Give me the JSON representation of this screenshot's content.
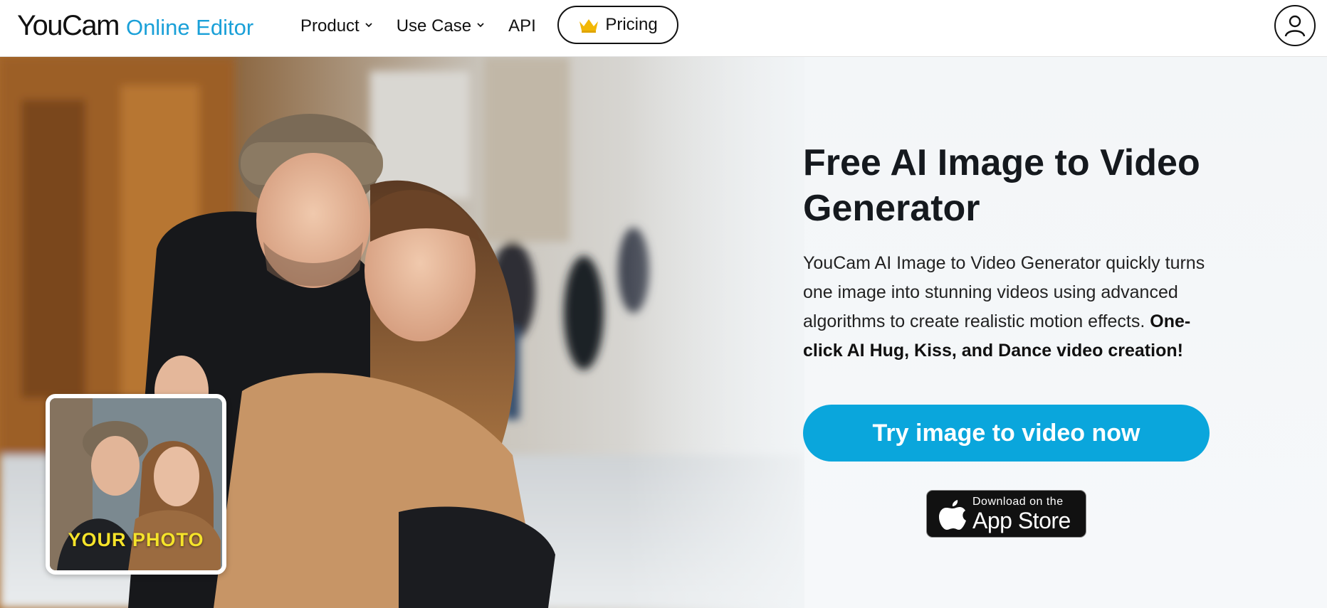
{
  "header": {
    "logo_main": "YouCam",
    "logo_sub": "Online Editor",
    "nav": [
      {
        "label": "Product",
        "has_dropdown": true
      },
      {
        "label": "Use Case",
        "has_dropdown": true
      },
      {
        "label": "API",
        "has_dropdown": false
      }
    ],
    "pricing_label": "Pricing",
    "pricing_icon": "crown-icon",
    "account_icon": "user-icon"
  },
  "hero": {
    "title": "Free AI Image to Video Generator",
    "description": "YouCam AI Image to Video Generator quickly turns one image into stunning videos using advanced algorithms to create realistic motion effects. ",
    "description_bold": "One-click AI Hug, Kiss, and Dance video creation!",
    "cta_label": "Try image to video now",
    "thumbnail_label": "YOUR PHOTO",
    "app_store_small": "Download on the",
    "app_store_big": "App Store"
  },
  "colors": {
    "brand_blue": "#1aa0d8",
    "cta_blue": "#0aa6dc",
    "thumb_label": "#f5e32a",
    "crown_gold": "#f2b705"
  }
}
